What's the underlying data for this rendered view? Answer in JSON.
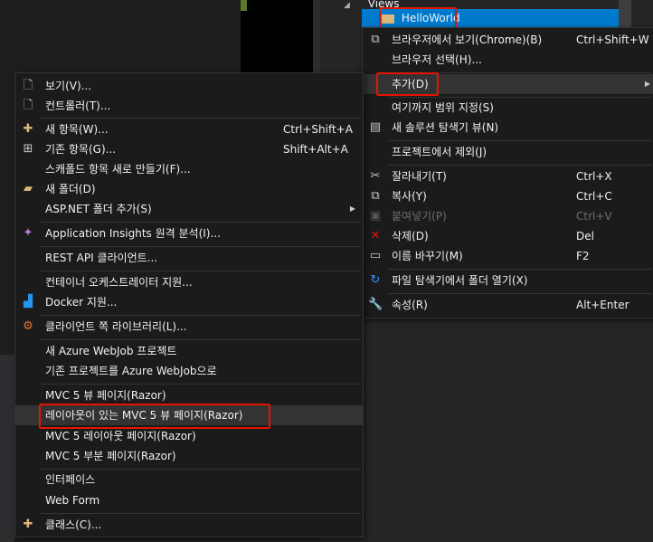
{
  "solution_explorer": {
    "views_label": "Views",
    "selected_folder": "HelloWorld"
  },
  "right_menu": {
    "items": [
      {
        "label": "브라우저에서 보기(Chrome)(B)",
        "shortcut": "Ctrl+Shift+W",
        "icon": "browser-view-icon"
      },
      {
        "label": "브라우저 선택(H)...",
        "shortcut": ""
      },
      {
        "label": "추가(D)",
        "shortcut": "",
        "submenu": true
      },
      {
        "label": "여기까지 범위 지정(S)",
        "shortcut": ""
      },
      {
        "label": "새 솔루션 탐색기 뷰(N)",
        "shortcut": "",
        "icon": "solution-explorer-icon"
      },
      {
        "label": "프로젝트에서 제외(J)",
        "shortcut": ""
      },
      {
        "label": "잘라내기(T)",
        "shortcut": "Ctrl+X",
        "icon": "cut-icon"
      },
      {
        "label": "복사(Y)",
        "shortcut": "Ctrl+C",
        "icon": "copy-icon"
      },
      {
        "label": "붙여넣기(P)",
        "shortcut": "Ctrl+V",
        "icon": "paste-icon",
        "disabled": true
      },
      {
        "label": "삭제(D)",
        "shortcut": "Del",
        "icon": "delete-icon"
      },
      {
        "label": "이름 바꾸기(M)",
        "shortcut": "F2",
        "icon": "rename-icon"
      },
      {
        "label": "파일 탐색기에서 폴더 열기(X)",
        "shortcut": "",
        "icon": "refresh-icon"
      },
      {
        "label": "속성(R)",
        "shortcut": "Alt+Enter",
        "icon": "wrench-icon"
      }
    ]
  },
  "add_submenu": {
    "items": [
      {
        "label": "보기(V)...",
        "shortcut": ""
      },
      {
        "label": "컨트롤러(T)...",
        "shortcut": ""
      },
      {
        "label": "새 항목(W)...",
        "shortcut": "Ctrl+Shift+A"
      },
      {
        "label": "기존 항목(G)...",
        "shortcut": "Shift+Alt+A"
      },
      {
        "label": "스캐폴드 항목 새로 만들기(F)...",
        "shortcut": ""
      },
      {
        "label": "새 폴더(D)",
        "shortcut": ""
      },
      {
        "label": "ASP.NET 폴더 추가(S)",
        "shortcut": "",
        "submenu": true
      },
      {
        "label": "Application Insights 원격 분석(I)...",
        "shortcut": ""
      },
      {
        "label": "REST API 클라이언트...",
        "shortcut": ""
      },
      {
        "label": "컨테이너 오케스트레이터 지원...",
        "shortcut": ""
      },
      {
        "label": "Docker 지원...",
        "shortcut": ""
      },
      {
        "label": "클라이언트 쪽 라이브러리(L)...",
        "shortcut": ""
      },
      {
        "label": "새 Azure WebJob 프로젝트",
        "shortcut": ""
      },
      {
        "label": "기존 프로젝트를 Azure WebJob으로",
        "shortcut": ""
      },
      {
        "label": "MVC 5 뷰 페이지(Razor)",
        "shortcut": ""
      },
      {
        "label": "레이아웃이 있는 MVC 5 뷰 페이지(Razor)",
        "shortcut": ""
      },
      {
        "label": "MVC 5 레이아웃 페이지(Razor)",
        "shortcut": ""
      },
      {
        "label": "MVC 5 부분 페이지(Razor)",
        "shortcut": ""
      },
      {
        "label": "인터페이스",
        "shortcut": ""
      },
      {
        "label": "Web Form",
        "shortcut": ""
      },
      {
        "label": "클래스(C)...",
        "shortcut": ""
      }
    ]
  },
  "colors": {
    "menu_bg": "#1b1b1c",
    "highlight": "#333334",
    "selection": "#007acc",
    "annotation_red": "#e51400"
  }
}
